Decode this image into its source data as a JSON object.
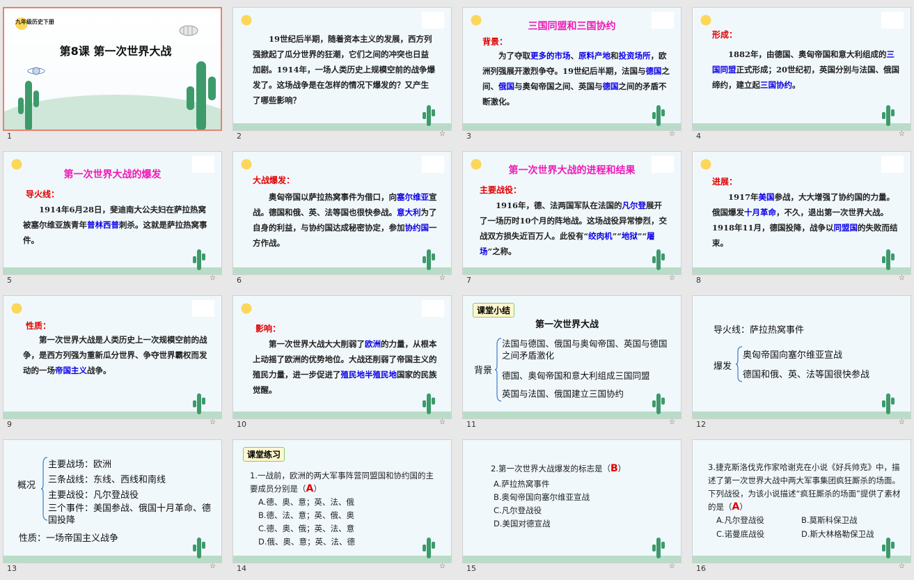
{
  "slides": {
    "s1": {
      "num": "1",
      "header": "九年级历史下册",
      "title": "第8课  第一次世界大战"
    },
    "s2": {
      "num": "2",
      "body": "19世纪后半期，随着资本主义的发展，西方列强掀起了瓜分世界的狂潮，它们之间的冲突也日益加剧。1914年，一场人类历史上规模空前的战争爆发了。这场战争是在怎样的情况下爆发的？又产生了哪些影响？"
    },
    "s3": {
      "num": "3",
      "title": "三国同盟和三国协约",
      "label": "背景：",
      "parts": [
        "为了夺取",
        "更多的市场",
        "、",
        "原料产地",
        "和",
        "投资场所",
        "，欧洲列强展开激烈争夺。19世纪后半期，法国与",
        "德国",
        "之间、",
        "俄国",
        "与奥匈帝国之间、英国与",
        "德国",
        "之间的矛盾不断激化。"
      ]
    },
    "s4": {
      "num": "4",
      "label": "形成：",
      "parts": [
        "1882年，由德国、奥匈帝国和意大利组成的",
        "三国同盟",
        "正式形成；20世纪初，英国分别与法国、俄国缔约，建立起",
        "三国协约",
        "。"
      ]
    },
    "s5": {
      "num": "5",
      "title": "第一次世界大战的爆发",
      "label": "导火线：",
      "parts": [
        "1914年6月28日，斐迪南大公夫妇在萨拉热窝被塞尔维亚族青年",
        "普林西普",
        "刺杀。这就是萨拉热窝事件。"
      ]
    },
    "s6": {
      "num": "6",
      "label": "大战爆发：",
      "parts": [
        "奥匈帝国以萨拉热窝事件为借口，向",
        "塞尔维亚",
        "宣战。德国和俄、英、法等国也很快参战。",
        "意大利",
        "为了自身的利益，与协约国达成秘密协定，参加",
        "协约国",
        "一方作战。"
      ]
    },
    "s7": {
      "num": "7",
      "title": "第一次世界大战的进程和结果",
      "label": "主要战役：",
      "parts": [
        "1916年，德、法两国军队在法国的",
        "凡尔登",
        "展开了一场历时10个月的阵地战。这场战役异常惨烈，交战双方损失近百万人。此役有“",
        "绞肉机",
        "”“",
        "地狱",
        "”“",
        "屠场",
        "”之称。"
      ]
    },
    "s8": {
      "num": "8",
      "label": "进展：",
      "parts": [
        "1917年",
        "美国",
        "参战，大大增强了协约国的力量。俄国爆发",
        "十月革命",
        "，不久，退出第一次世界大战。1918年11月，德国投降，战争以",
        "同盟国",
        "的失败而结束。"
      ]
    },
    "s9": {
      "num": "9",
      "label": "性质：",
      "parts": [
        "第一次世界大战是人类历史上一次规模空前的战争，是西方列强为重新瓜分世界、争夺世界霸权而发动的一场",
        "帝国主义",
        "战争。"
      ]
    },
    "s10": {
      "num": "10",
      "label": "影响：",
      "parts": [
        "第一次世界大战大大削弱了",
        "欧洲",
        "的力量，从根本上动摇了欧洲的优势地位。大战还削弱了帝国主义的殖民力量，进一步促进了",
        "殖民地半殖民地",
        "国家的民族觉醒。"
      ]
    },
    "s11": {
      "num": "11",
      "tag": "课堂小结",
      "title": "第一次世界大战",
      "side": "背景",
      "items": [
        "法国与德国、俄国与奥匈帝国、英国与德国之间矛盾激化",
        "德国、奥匈帝国和意大利组成三国同盟",
        "英国与法国、俄国建立三国协约"
      ]
    },
    "s12": {
      "num": "12",
      "line1": "导火线：萨拉热窝事件",
      "side": "爆发",
      "items": [
        "奥匈帝国向塞尔维亚宣战",
        "德国和俄、英、法等国很快参战"
      ]
    },
    "s13": {
      "num": "13",
      "side": "概况",
      "items": [
        "主要战场：欧洲",
        "三条战线：东线、西线和南线",
        "主要战役：凡尔登战役",
        "三个事件：美国参战、俄国十月革命、德国投降"
      ],
      "nature": "性质：一场帝国主义战争"
    },
    "s14": {
      "num": "14",
      "tag": "课堂练习",
      "q": "1.一战前，欧洲的两大军事阵营同盟国和协约国的主要成员分别是（",
      "ans": "A",
      "close": "）",
      "opts": [
        "A.德、奥、意；英、法、俄",
        "B.德、法、意；英、俄、奥",
        "C.德、奥、俄；英、法、意",
        "D.俄、奥、意；英、法、德"
      ]
    },
    "s15": {
      "num": "15",
      "q": "2.第一次世界大战爆发的标志是（",
      "ans": "B",
      "close": "）",
      "opts": [
        "A.萨拉热窝事件",
        "B.奥匈帝国向塞尔维亚宣战",
        "C.凡尔登战役",
        "D.美国对德宣战"
      ]
    },
    "s16": {
      "num": "16",
      "q": "3.捷克斯洛伐克作家哈谢克在小说《好兵帅克》中，描述了第一次世界大战中两大军事集团疯狂厮杀的场面。下列战役，为该小说描述“疯狂厮杀的场面”提供了素材的是（",
      "ans": "A",
      "close": "）",
      "opts": [
        "A.凡尔登战役",
        "B.莫斯科保卫战",
        "C.诺曼底战役",
        "D.斯大林格勒保卫战"
      ]
    }
  },
  "star_icon": "☆",
  "colors": {
    "highlight": "#0b00e6",
    "label": "#e10000",
    "title": "#ee1bb6",
    "selected_border": "#e8826c"
  }
}
